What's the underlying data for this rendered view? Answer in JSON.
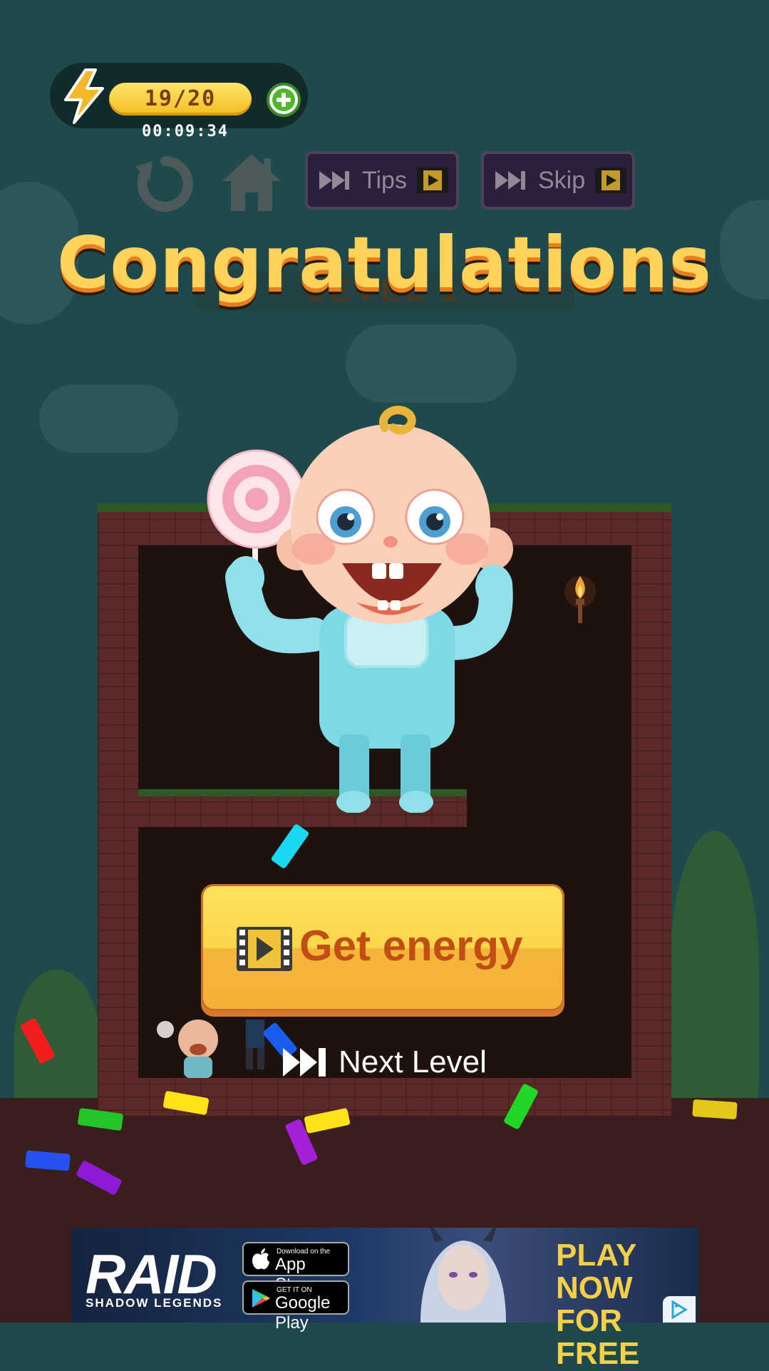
{
  "hud": {
    "energy": "19/20",
    "timer": "00:09:34",
    "tips_label": "Tips",
    "skip_label": "Skip"
  },
  "title": "Congratulations",
  "level_plate": "LEVEL 1",
  "buttons": {
    "get_energy": "Get energy",
    "next_level": "Next Level"
  },
  "ad": {
    "brand": "RAID",
    "brand_sub": "SHADOW LEGENDS",
    "app_store_small": "Download on the",
    "app_store_big": "App Store",
    "google_small": "GET IT ON",
    "google_big": "Google Play",
    "cta_line1": "PLAY NOW",
    "cta_line2": "FOR FREE"
  },
  "colors": {
    "background": "#1f4a4b",
    "title_fill": "#ffd25c",
    "button_yellow": "#fcd64a",
    "button_text": "#c04e15",
    "energy_pill": "#f2bd1e"
  }
}
